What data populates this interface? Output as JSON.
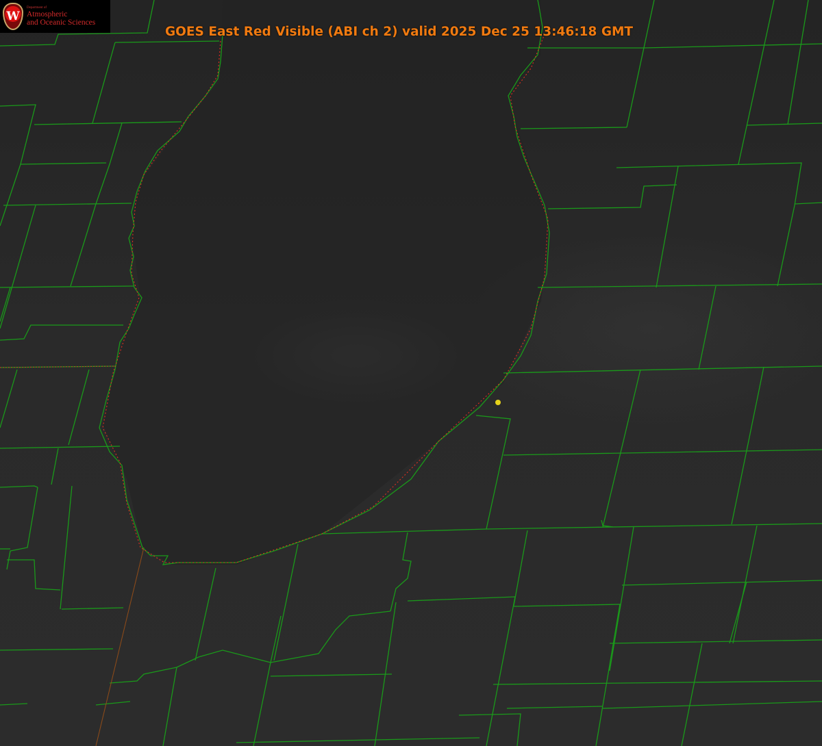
{
  "header": {
    "title": "GOES East Red Visible (ABI ch 2) valid 2025 Dec 25 13:46:18 GMT"
  },
  "logo": {
    "crest_letter": "W",
    "department_label": "Department of",
    "line1": "Atmospheric",
    "line2": "and Oceanic Sciences"
  },
  "map": {
    "layers": [
      "satellite-imagery",
      "county-boundaries",
      "state-boundaries",
      "shoreline"
    ],
    "colors": {
      "county_lines": "#1a9a1a",
      "state_lines": "#c0392b",
      "title_text": "#f07a10",
      "marker": "#e5d21a"
    },
    "icons": [
      "location-marker-icon"
    ]
  }
}
